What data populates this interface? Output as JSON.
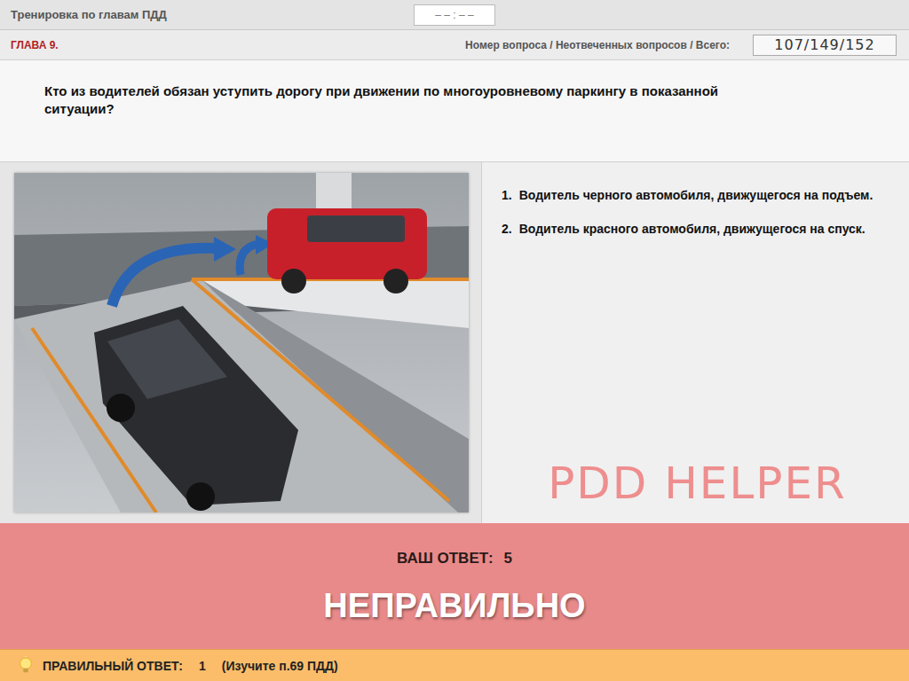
{
  "header": {
    "title": "Тренировка по главам ПДД",
    "timer": "– – : – –"
  },
  "info_bar": {
    "chapter": "ГЛАВА 9.",
    "counter_label": "Номер вопроса / Неотвеченных вопросов / Всего:",
    "counter": "107/149/152"
  },
  "question": {
    "text": "Кто из водителей обязан уступить дорогу при движении по многоуровневому паркингу в показанной ситуации?"
  },
  "answers": [
    {
      "number": "1.",
      "text": "Водитель черного автомобиля, движущегося на подъем."
    },
    {
      "number": "2.",
      "text": "Водитель красного автомобиля, движущегося на спуск."
    }
  ],
  "watermark": "PDD HELPER",
  "result": {
    "your_answer_label": "ВАШ  ОТВЕТ:",
    "your_answer": "5",
    "verdict": "НЕПРАВИЛЬНО"
  },
  "footer": {
    "correct_label": "ПРАВИЛЬНЫЙ ОТВЕТ:",
    "correct_answer": "1",
    "hint": "(Изучите п.69 ПДД)"
  }
}
